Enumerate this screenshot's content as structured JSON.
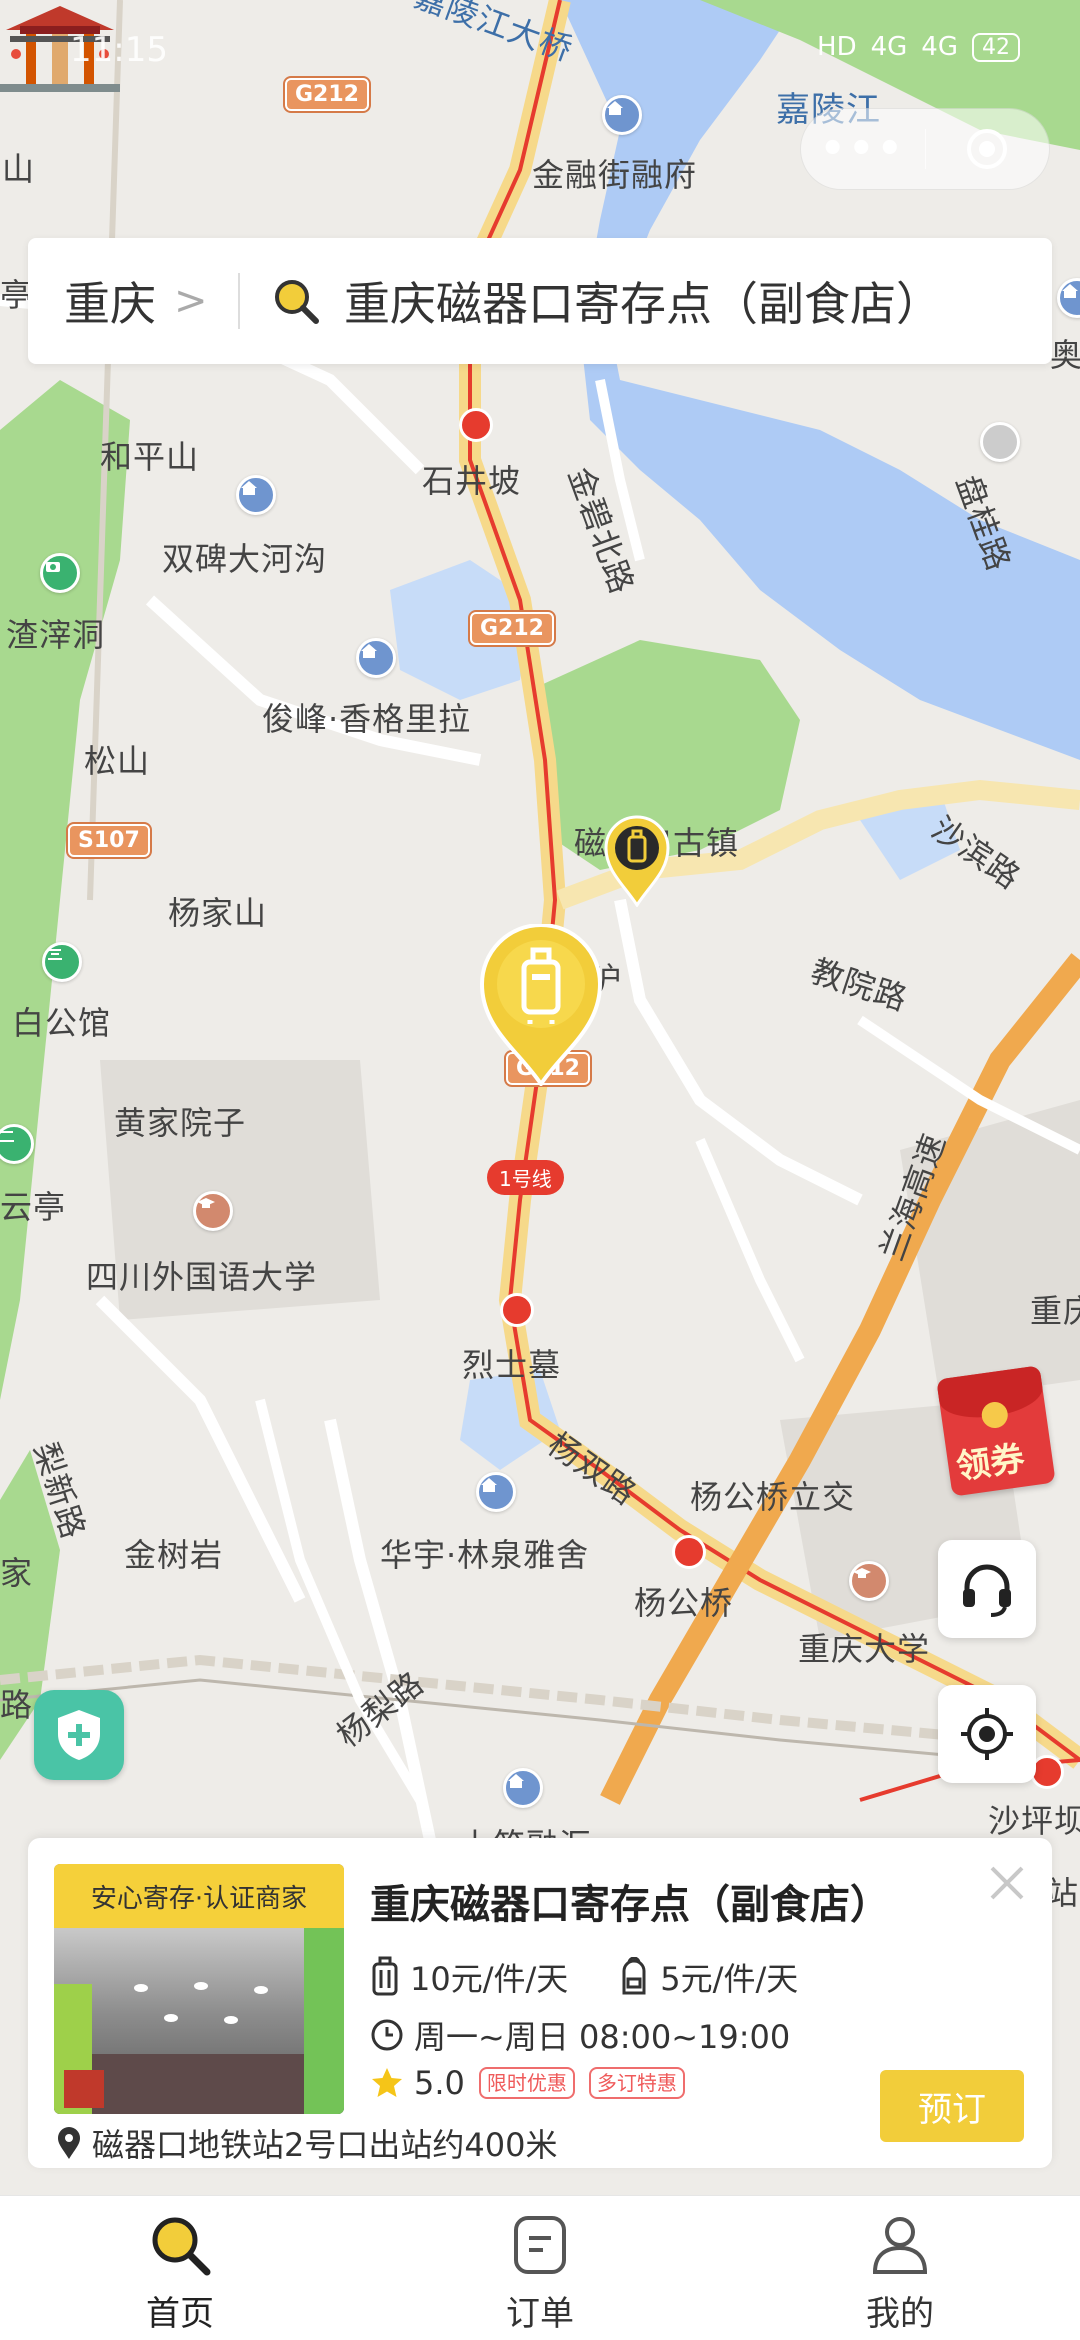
{
  "status_bar": {
    "time": "11:15",
    "network": "HD",
    "signal1": "4G",
    "signal2": "4G",
    "battery": "42"
  },
  "capsule": {
    "more_icon": "more-dots-icon",
    "close_icon": "target-circle-icon"
  },
  "search": {
    "city": "重庆",
    "query": "重庆磁器口寄存点（副食店）"
  },
  "map": {
    "labels": {
      "jialingjiang_bridge": "嘉陵江大桥",
      "jialingjiang": "嘉陵江",
      "jinrongjie": "金融街融府",
      "shan": "山",
      "ting": "亭",
      "ao": "奥",
      "hepingshan": "和平山",
      "shijingpo": "石井坡",
      "jinbibeilu": "金碧北路",
      "panguilu": "盘桂路",
      "shuangbei": "双碑大河沟",
      "zhazidong": "渣滓洞",
      "junfeng": "俊峰·香格里拉",
      "songshan": "松山",
      "ciqikou": "磁器口古镇",
      "shabinlu": "沙滨路",
      "yangjiashan": "杨家山",
      "jiaoyuanlu": "教院路",
      "baigongguan": "白公馆",
      "huangjiayuanzi": "黄家院子",
      "yunting": "云亭",
      "sisu": "四川外国语大学",
      "hu": "沪",
      "lanhai": "兰海高速",
      "chongqing_right": "重庆",
      "lieshimu": "烈士墓",
      "yangshuanglu": "杨双路",
      "yanggongqiao_lijiao": "杨公桥立交",
      "lixinlu": "梨新路",
      "jinshuyan": "金树岩",
      "huayu": "华宇·林泉雅舍",
      "jia": "家",
      "yanggongqiao": "杨公桥",
      "cqu": "重庆大学",
      "lu": "路",
      "yanglilu": "杨梨路",
      "shapingba": "沙坪坝",
      "shangzhu": "上筑融汇",
      "zhan": "站"
    },
    "badges": {
      "g212_a": "G212",
      "g212_b": "G212",
      "g212_c": "G212",
      "s107": "S107",
      "line1": "1号线"
    }
  },
  "coupon": {
    "label": "领券"
  },
  "store": {
    "badge": "安心寄存·认证商家",
    "name": "重庆磁器口寄存点（副食店）",
    "price_suitcase": "10元/件/天",
    "price_backpack": "5元/件/天",
    "hours": "周一~周日 08:00~19:00",
    "rating": "5.0",
    "promo1": "限时优惠",
    "promo2": "多订特惠",
    "book_label": "预订",
    "distance": "磁器口地铁站2号口出站约400米"
  },
  "tabs": [
    {
      "label": "首页",
      "icon": "search-icon",
      "active": true
    },
    {
      "label": "订单",
      "icon": "order-icon",
      "active": false
    },
    {
      "label": "我的",
      "icon": "user-icon",
      "active": false
    }
  ],
  "colors": {
    "accent": "#f2cd3a",
    "metro": "#e63b2e",
    "water": "#aecbf5",
    "park": "#a8d98f"
  }
}
